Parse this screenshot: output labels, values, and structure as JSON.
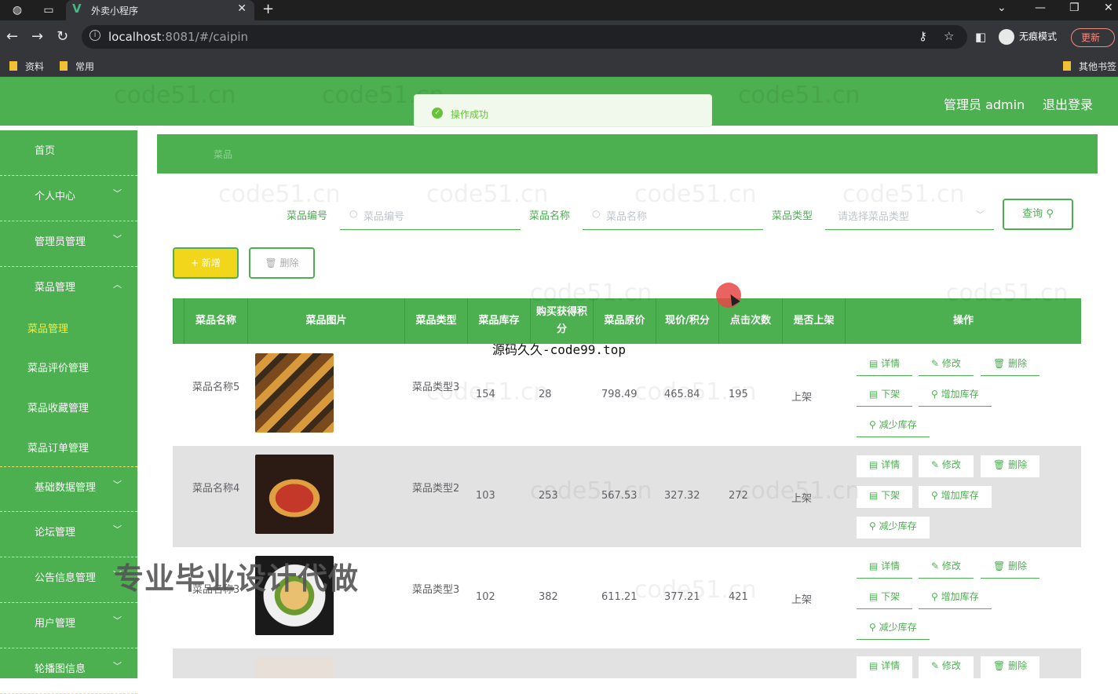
{
  "browser": {
    "tab_title": "外卖小程序",
    "url_host": "localhost",
    "url_rest": ":8081/#/caipin",
    "incognito_label": "无痕模式",
    "update_label": "更新",
    "bookmarks": [
      "资料",
      "常用"
    ],
    "other_bookmarks": "其他书签"
  },
  "header": {
    "user": "管理员 admin",
    "logout": "退出登录"
  },
  "toast": {
    "message": "操作成功"
  },
  "sidebar": {
    "items": [
      {
        "label": "首页"
      },
      {
        "label": "个人中心"
      },
      {
        "label": "管理员管理"
      },
      {
        "label": "菜品管理"
      },
      {
        "label": "基础数据管理"
      },
      {
        "label": "论坛管理"
      },
      {
        "label": "公告信息管理"
      },
      {
        "label": "用户管理"
      },
      {
        "label": "轮播图信息"
      }
    ],
    "sub_items": [
      {
        "label": "菜品管理"
      },
      {
        "label": "菜品评价管理"
      },
      {
        "label": "菜品收藏管理"
      },
      {
        "label": "菜品订单管理"
      }
    ]
  },
  "breadcrumb": {
    "label": "菜品"
  },
  "filters": {
    "code_label": "菜品编号",
    "code_placeholder": "菜品编号",
    "name_label": "菜品名称",
    "name_placeholder": "菜品名称",
    "type_label": "菜品类型",
    "type_placeholder": "请选择菜品类型",
    "query_button": "查询"
  },
  "toolbar": {
    "add_label": "+ 新增",
    "delete_label": "删除"
  },
  "table": {
    "headers": [
      "菜品名称",
      "菜品图片",
      "菜品类型",
      "菜品库存",
      "购买获得积分",
      "菜品原价",
      "现价/积分",
      "点击次数",
      "是否上架",
      "操作"
    ],
    "actions": [
      "详情",
      "修改",
      "删除",
      "下架",
      "增加库存",
      "减少库存"
    ],
    "rows": [
      {
        "name": "菜品名称5",
        "type": "菜品类型3",
        "stock": "154",
        "points": "28",
        "price": "798.49",
        "now_price": "465.84",
        "clicks": "195",
        "status": "上架"
      },
      {
        "name": "菜品名称4",
        "type": "菜品类型2",
        "stock": "103",
        "points": "253",
        "price": "567.53",
        "now_price": "327.32",
        "clicks": "272",
        "status": "上架"
      },
      {
        "name": "菜品名称3",
        "type": "菜品类型3",
        "stock": "102",
        "points": "382",
        "price": "611.21",
        "now_price": "377.21",
        "clicks": "421",
        "status": "上架"
      }
    ]
  },
  "watermark": "code51.cn",
  "overlays": {
    "code_text": "源码久久-code99.top",
    "promo_text": "专业毕业设计代做"
  },
  "colors": {
    "primary": "#4caf50",
    "accent": "#ffeb3b",
    "add_button": "#f2d61c"
  }
}
